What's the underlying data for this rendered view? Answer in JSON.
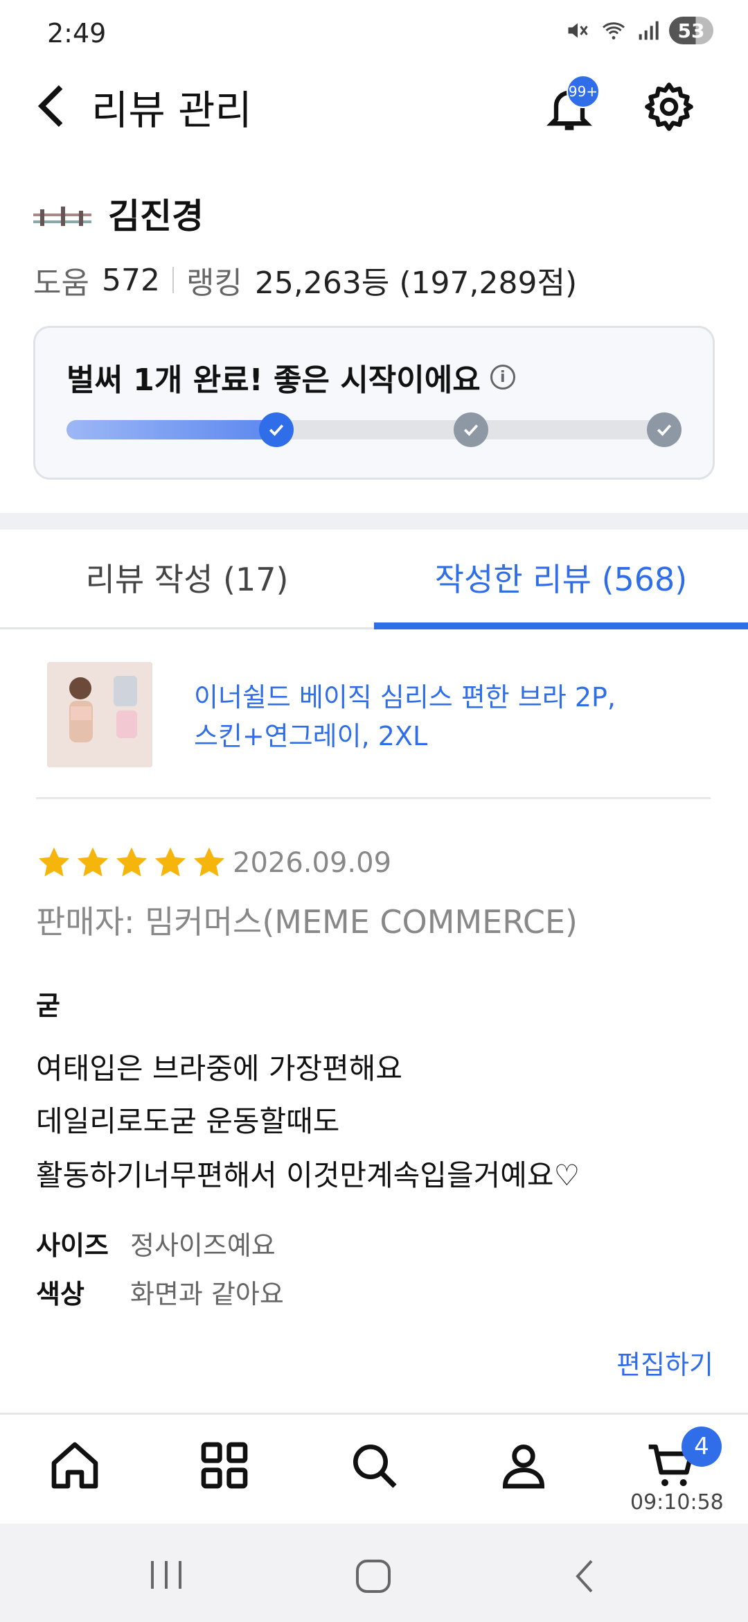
{
  "status_bar": {
    "time": "2:49",
    "battery": "53"
  },
  "header": {
    "title": "리뷰 관리",
    "notification_badge": "99+"
  },
  "profile": {
    "name": "김진경",
    "help_label": "도움",
    "help_value": "572",
    "ranking_label": "랭킹",
    "ranking_value": "25,263등 (197,289점)"
  },
  "progress": {
    "title": "벌써 1개 완료! 좋은 시작이에요",
    "completed": 1,
    "total": 3
  },
  "tabs": [
    {
      "label": "리뷰 작성 (17)",
      "active": false
    },
    {
      "label": "작성한 리뷰 (568)",
      "active": true
    }
  ],
  "product": {
    "name_line1": "이너쉴드 베이직 심리스 편한 브라 2P,",
    "name_line2": "스킨+연그레이, 2XL"
  },
  "review": {
    "rating": 5,
    "date": "2026.09.09",
    "seller": "판매자: 밈커머스(MEME COMMERCE)",
    "title": "굳",
    "lines": [
      "여태입은 브라중에 가장편해요",
      "데일리로도굳 운동할때도",
      "활동하기너무편해서 이것만계속입을거예요♡"
    ],
    "attributes": [
      {
        "key": "사이즈",
        "value": "정사이즈예요"
      },
      {
        "key": "색상",
        "value": "화면과 같아요"
      }
    ],
    "edit_label": "편집하기"
  },
  "bottom_nav": {
    "cart_count": "4",
    "timer": "09:10:58"
  },
  "colors": {
    "accent": "#2f6ee8",
    "star": "#f5b50a"
  }
}
